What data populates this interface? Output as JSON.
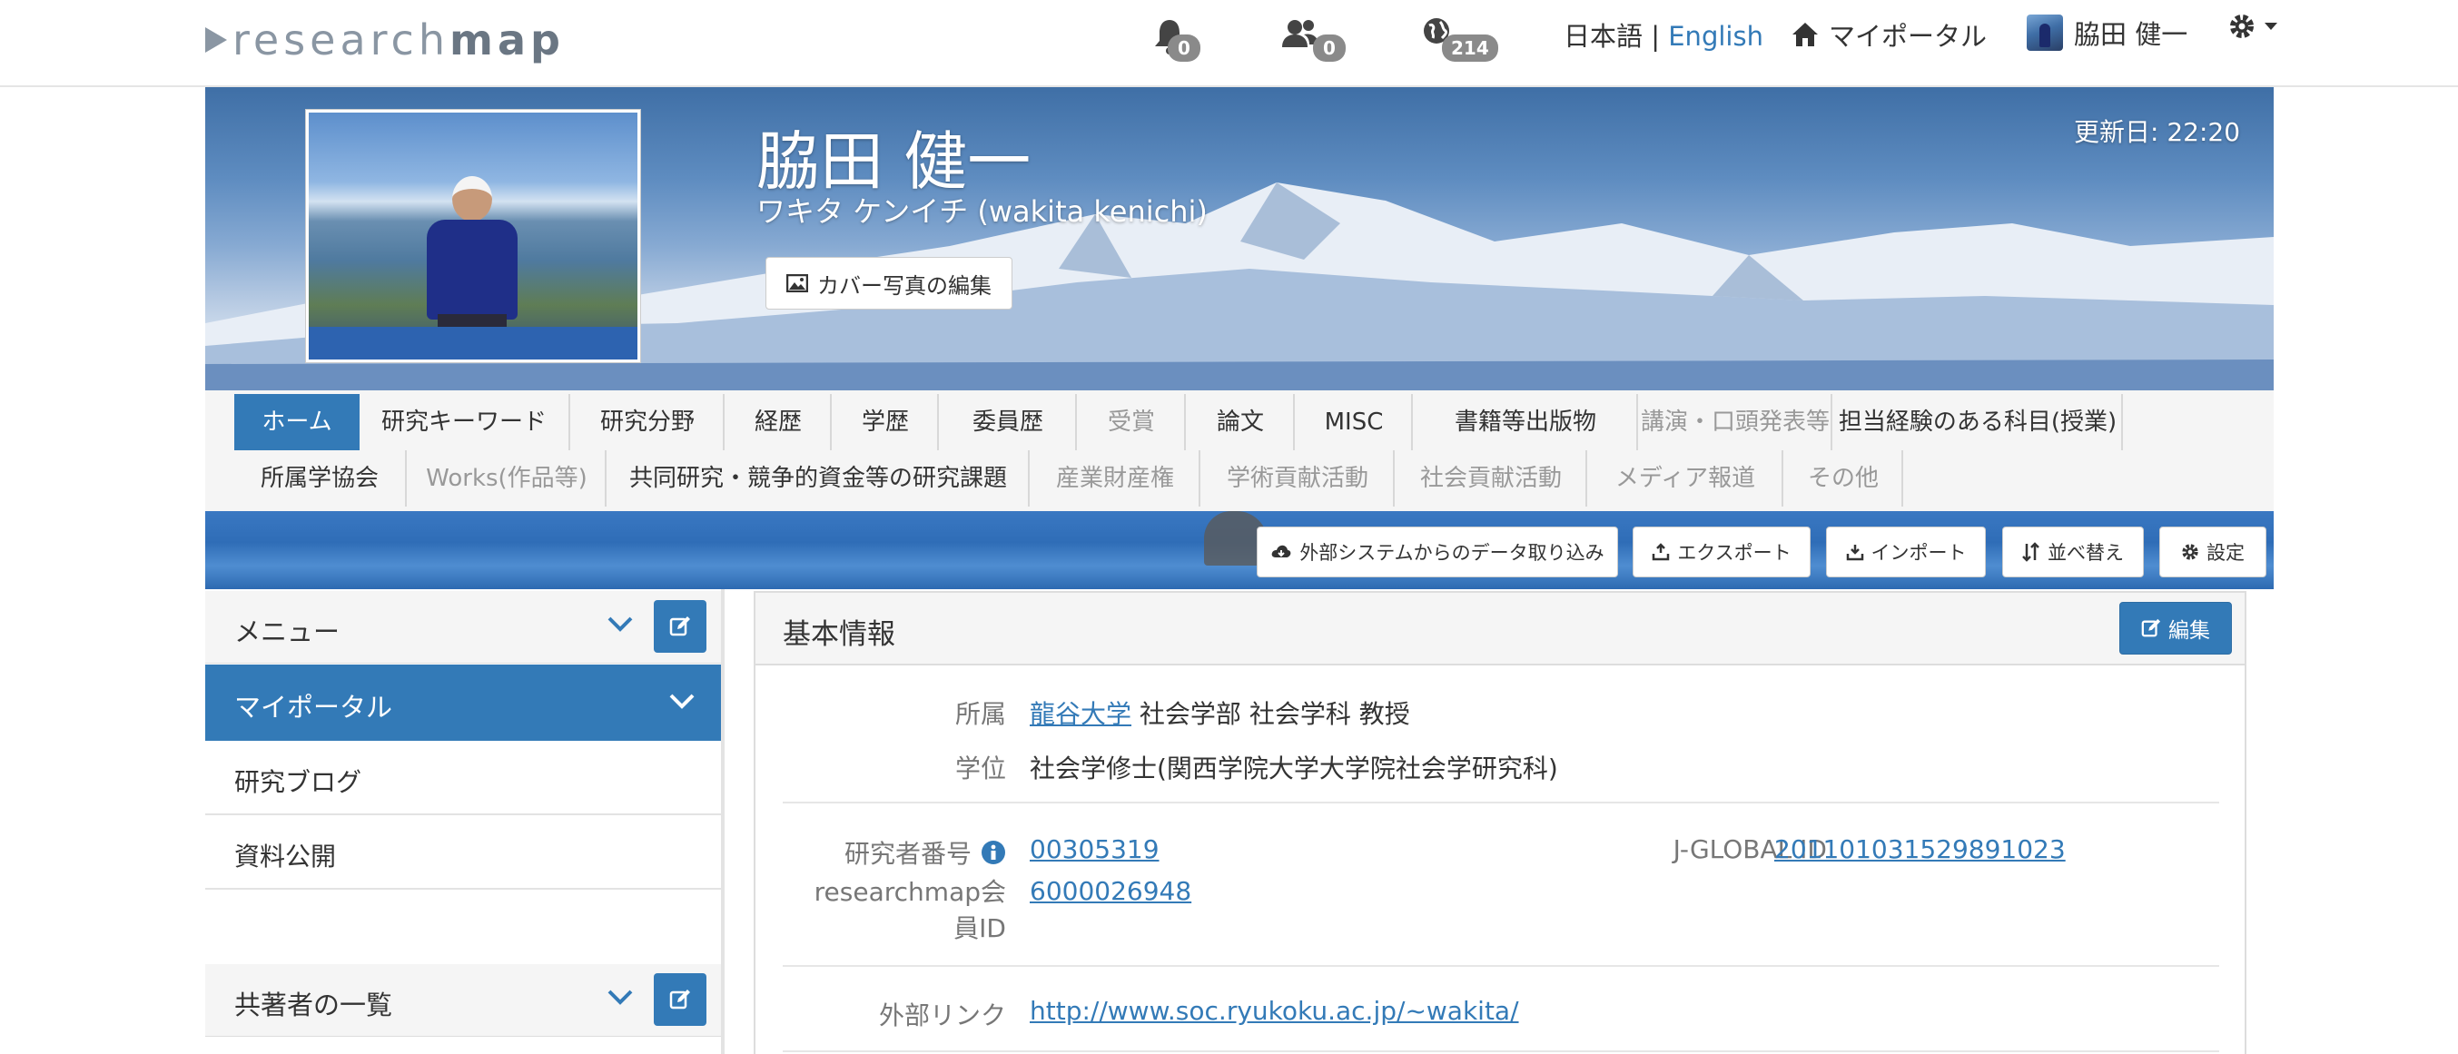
{
  "logo": {
    "part1": "research",
    "part2": "map"
  },
  "topnav": {
    "notifications_count": "0",
    "users_count": "0",
    "world_count": "214",
    "lang_ja": "日本語",
    "lang_sep": "|",
    "lang_en": "English",
    "myportal": "マイポータル",
    "user_name": "脇田 健一"
  },
  "profile": {
    "name": "脇田 健一",
    "kana": "ワキタ ケンイチ  (wakita kenichi)",
    "updated": "更新日: 22:20",
    "cover_edit_button": "カバー写真の編集"
  },
  "tabs_row1": [
    {
      "label": "ホーム",
      "state": "active"
    },
    {
      "label": "研究キーワード",
      "state": "normal"
    },
    {
      "label": "研究分野",
      "state": "normal"
    },
    {
      "label": "経歴",
      "state": "normal"
    },
    {
      "label": "学歴",
      "state": "normal"
    },
    {
      "label": "委員歴",
      "state": "normal"
    },
    {
      "label": "受賞",
      "state": "dim"
    },
    {
      "label": "論文",
      "state": "normal"
    },
    {
      "label": "MISC",
      "state": "normal"
    },
    {
      "label": "書籍等出版物",
      "state": "normal"
    },
    {
      "label": "講演・口頭発表等",
      "state": "dim"
    },
    {
      "label": "担当経験のある科目(授業)",
      "state": "normal"
    }
  ],
  "tabs_row2": [
    {
      "label": "所属学協会",
      "state": "normal"
    },
    {
      "label": "Works(作品等)",
      "state": "dim"
    },
    {
      "label": "共同研究・競争的資金等の研究課題",
      "state": "normal"
    },
    {
      "label": "産業財産権",
      "state": "dim"
    },
    {
      "label": "学術貢献活動",
      "state": "dim"
    },
    {
      "label": "社会貢献活動",
      "state": "dim"
    },
    {
      "label": "メディア報道",
      "state": "dim"
    },
    {
      "label": "その他",
      "state": "dim"
    }
  ],
  "toolbar": {
    "import_external": "外部システムからのデータ取り込み",
    "export": "エクスポート",
    "import": "インポート",
    "sort": "並べ替え",
    "settings": "設定"
  },
  "sidebar": {
    "menu_label": "メニュー",
    "myportal_label": "マイポータル",
    "items": [
      "研究ブログ",
      "資料公開"
    ],
    "coauthors_label": "共著者の一覧"
  },
  "basic_info": {
    "title": "基本情報",
    "edit_button": "編集",
    "affiliation_label": "所属",
    "affiliation_link": "龍谷大学",
    "affiliation_rest": "社会学部 社会学科 教授",
    "degree_label": "学位",
    "degree_value": "社会学修士(関西学院大学大学院社会学研究科)",
    "researcher_no_label": "研究者番号",
    "researcher_no": "00305319",
    "member_id_label_1": "researchmap会",
    "member_id_label_2": "員ID",
    "member_id": "6000026948",
    "jglobal_label": "J-GLOBAL ID",
    "jglobal_id": "201101031529891023",
    "external_link_label": "外部リンク",
    "external_link": "http://www.soc.ryukoku.ac.jp/~wakita/"
  },
  "colors": {
    "primary": "#337ab7",
    "badge": "#8a8a8a",
    "tab_bg": "#f5f5f5"
  }
}
